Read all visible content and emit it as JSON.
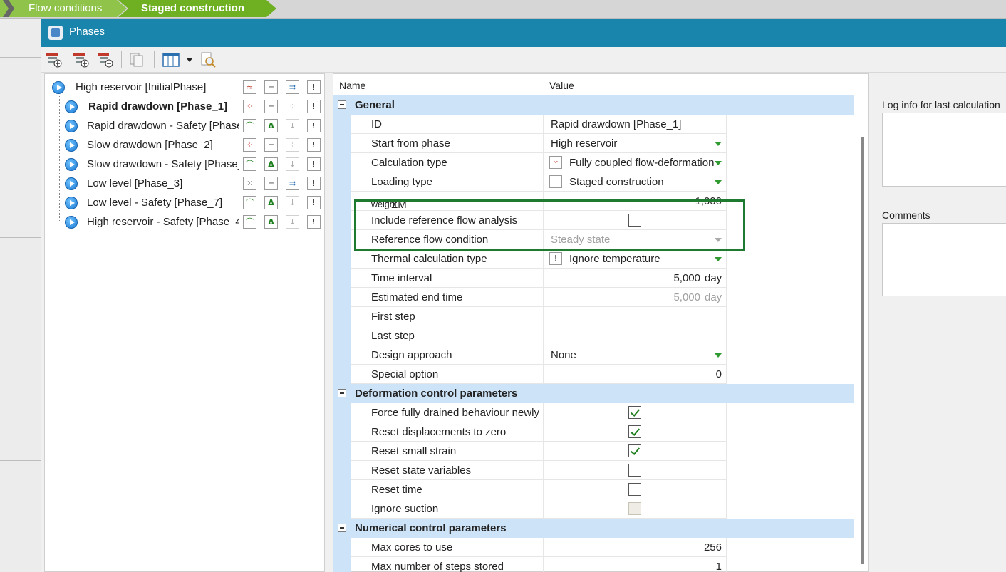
{
  "breadcrumb": {
    "items": [
      "Flow conditions",
      "Staged construction"
    ]
  },
  "window": {
    "title": "Phases"
  },
  "tree": {
    "phases": [
      {
        "label": "High reservoir [InitialPhase]",
        "bold": false
      },
      {
        "label": "Rapid drawdown [Phase_1]",
        "bold": true
      },
      {
        "label": "Rapid drawdown - Safety [Phase",
        "bold": false
      },
      {
        "label": "Slow drawdown [Phase_2]",
        "bold": false
      },
      {
        "label": "Slow drawdown - Safety [Phase_",
        "bold": false
      },
      {
        "label": "Low level [Phase_3]",
        "bold": false
      },
      {
        "label": "Low level - Safety [Phase_7]",
        "bold": false
      },
      {
        "label": "High reservoir - Safety [Phase_4",
        "bold": false
      }
    ]
  },
  "grid": {
    "headers": {
      "name": "Name",
      "value": "Value"
    },
    "sections": {
      "general": "General",
      "deformation": "Deformation control parameters",
      "numerical": "Numerical control parameters"
    },
    "rows": {
      "id": {
        "name": "ID",
        "value": "Rapid drawdown [Phase_1]"
      },
      "start_from": {
        "name": "Start from phase",
        "value": "High reservoir"
      },
      "calc_type": {
        "name": "Calculation type",
        "value": "Fully coupled flow-deformation"
      },
      "loading_type": {
        "name": "Loading type",
        "value": "Staged construction"
      },
      "sum_m_weight": {
        "name": "ΣM",
        "sub": "weight",
        "value": "1,000"
      },
      "include_ref": {
        "name": "Include reference flow analysis",
        "checked": false
      },
      "ref_condition": {
        "name": "Reference flow condition",
        "value": "Steady state"
      },
      "thermal": {
        "name": "Thermal calculation type",
        "value": "Ignore temperature"
      },
      "time_interval": {
        "name": "Time interval",
        "value": "5,000",
        "unit": "day"
      },
      "est_end": {
        "name": "Estimated end time",
        "value": "5,000",
        "unit": "day"
      },
      "first_step": {
        "name": "First step",
        "value": ""
      },
      "last_step": {
        "name": "Last step",
        "value": ""
      },
      "design": {
        "name": "Design approach",
        "value": "None"
      },
      "special": {
        "name": "Special option",
        "value": "0"
      },
      "force_drained": {
        "name": "Force fully drained behaviour newly a",
        "checked": true
      },
      "reset_disp": {
        "name": "Reset displacements to zero",
        "checked": true
      },
      "reset_small": {
        "name": "Reset small strain",
        "checked": true
      },
      "reset_state": {
        "name": "Reset state variables",
        "checked": false
      },
      "reset_time": {
        "name": "Reset time",
        "checked": false
      },
      "ignore_suction": {
        "name": "Ignore suction",
        "checked": false
      },
      "max_cores": {
        "name": "Max cores to use",
        "value": "256"
      },
      "max_steps": {
        "name": "Max number of steps stored",
        "value": "1"
      }
    }
  },
  "right": {
    "log_label": "Log info for last calculation",
    "comments_label": "Comments"
  },
  "colors": {
    "title_bar": "#1985ac",
    "section_bg": "#cde3f7",
    "highlight": "#1e7a2e",
    "dropdown_arrow": "#2f9a2f"
  }
}
